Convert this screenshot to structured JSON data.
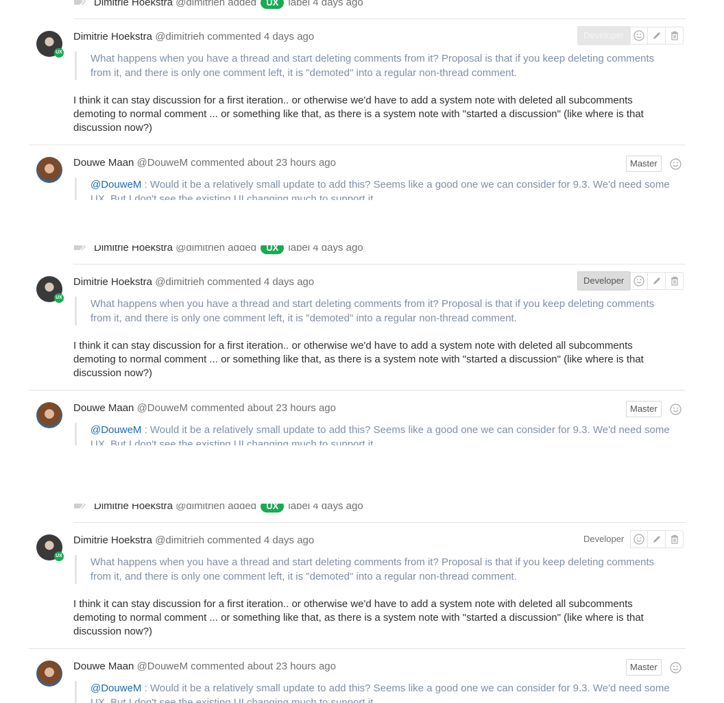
{
  "system_note": {
    "author": "Dimitrie Hoekstra",
    "handle": "@dimitrieh",
    "action": "added",
    "label": "UX",
    "suffix": "label 4 days ago"
  },
  "first_comment": {
    "author": "Dimitrie Hoekstra",
    "handle": "@dimitrieh",
    "time": "commented 4 days ago",
    "avatar_badge": "UX",
    "quote": "What happens when you have a thread and start deleting comments from it? Proposal is that if you keep deleting comments from it, and there is only one comment left, it is \"demoted\" into a regular non-thread comment.",
    "body": "I think it can stay discussion for a first iteration.. or otherwise we'd have to add a system note with deleted all subcomments demoting to normal comment ... or something like that, as there is a system note with \"started a discussion\" (like where is that discussion now?)",
    "role": "Developer"
  },
  "second_comment": {
    "author": "Douwe Maan",
    "handle": "@DouweM",
    "time": "commented about 23 hours ago",
    "role": "Master",
    "mention": "@DouweM",
    "quote_line1": " : Would it be a relatively small update to add this? Seems like a good one we can consider for 9.3. We'd need some",
    "quote_line2": "UX. But I don't see the existing UI changing much to support it."
  },
  "icons": [
    "tag-icon",
    "smiley-icon",
    "pencil-icon",
    "trash-icon"
  ],
  "colors": {
    "ux_badge": "#1aaa55",
    "quote_text": "#7f8fa4",
    "mention": "#1b69b6"
  }
}
